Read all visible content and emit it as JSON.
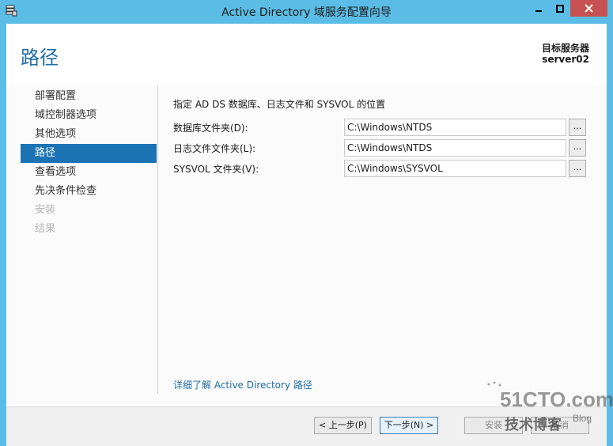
{
  "window": {
    "title": "Active Directory 域服务配置向导",
    "minimize_label": "0",
    "maximize_label": "1",
    "close_label": "r"
  },
  "header": {
    "page_title": "路径",
    "target_label": "目标服务器",
    "target_name": "server02"
  },
  "nav": {
    "items": [
      {
        "label": "部署配置",
        "state": "normal"
      },
      {
        "label": "域控制器选项",
        "state": "normal"
      },
      {
        "label": "其他选项",
        "state": "normal"
      },
      {
        "label": "路径",
        "state": "active"
      },
      {
        "label": "查看选项",
        "state": "normal"
      },
      {
        "label": "先决条件检查",
        "state": "normal"
      },
      {
        "label": "安装",
        "state": "disabled"
      },
      {
        "label": "结果",
        "state": "disabled"
      }
    ]
  },
  "content": {
    "heading": "指定 AD DS 数据库、日志文件和 SYSVOL 的位置",
    "fields": [
      {
        "label": "数据库文件夹(D):",
        "value": "C:\\Windows\\NTDS",
        "browse": "..."
      },
      {
        "label": "日志文件文件夹(L):",
        "value": "C:\\Windows\\NTDS",
        "browse": "..."
      },
      {
        "label": "SYSVOL 文件夹(V):",
        "value": "C:\\Windows\\SYSVOL",
        "browse": "..."
      }
    ],
    "learn_more": "详细了解 Active Directory 路径"
  },
  "footer": {
    "prev_label": "< 上一步(P)",
    "next_label": "下一步(N) >",
    "install_label": "安装",
    "cancel_label": "取消"
  },
  "watermark": {
    "main": "51CTO.com",
    "sub": "技术博客",
    "blog": "Blog"
  },
  "colors": {
    "frame": "#5bbde6",
    "accent": "#1c73b3",
    "close": "#c75050",
    "link": "#1f6ca5"
  }
}
